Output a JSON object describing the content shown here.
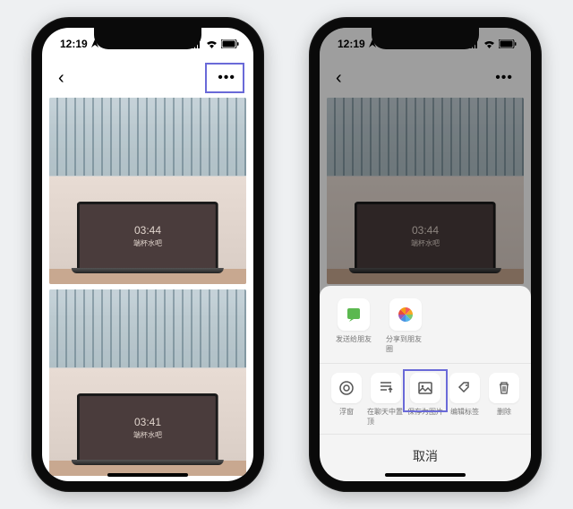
{
  "status": {
    "time": "12:19",
    "signal": "ıııl",
    "wifi": "✓",
    "battery": "▮"
  },
  "nav": {
    "back": "‹",
    "more": "•••"
  },
  "laptop1": {
    "time": "03:44",
    "text": "端杯水吧"
  },
  "laptop2": {
    "time": "03:41",
    "text": "端杯水吧"
  },
  "share": {
    "items": [
      {
        "name": "send-friend",
        "label": "发送给朋友"
      },
      {
        "name": "share-moments",
        "label": "分享到朋友圈"
      }
    ]
  },
  "actions": {
    "items": [
      {
        "name": "float",
        "label": "浮窗"
      },
      {
        "name": "chat-top",
        "label": "在聊天中置顶"
      },
      {
        "name": "save-image",
        "label": "保存为图片",
        "highlighted": true
      },
      {
        "name": "edit-tag",
        "label": "编辑标签"
      },
      {
        "name": "delete",
        "label": "删除"
      }
    ]
  },
  "cancel": "取消"
}
